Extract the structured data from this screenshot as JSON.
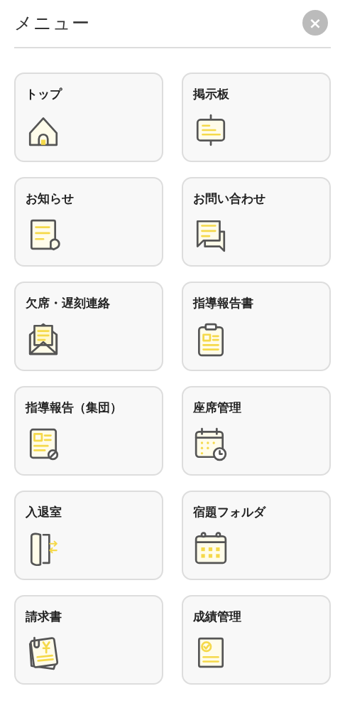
{
  "header": {
    "title": "メニュー",
    "close_label": "×"
  },
  "items": [
    {
      "label": "トップ",
      "kind": "home"
    },
    {
      "label": "掲示板",
      "kind": "board"
    },
    {
      "label": "お知らせ",
      "kind": "notice"
    },
    {
      "label": "お問い合わせ",
      "kind": "chat"
    },
    {
      "label": "欠席・遅刻連絡",
      "kind": "mail"
    },
    {
      "label": "指導報告書",
      "kind": "clipboard"
    },
    {
      "label": "指導報告（集団）",
      "kind": "report"
    },
    {
      "label": "座席管理",
      "kind": "calendar-clock"
    },
    {
      "label": "入退室",
      "kind": "door"
    },
    {
      "label": "宿題フォルダ",
      "kind": "calendar"
    },
    {
      "label": "請求書",
      "kind": "invoice"
    },
    {
      "label": "成績管理",
      "kind": "certificate"
    }
  ]
}
